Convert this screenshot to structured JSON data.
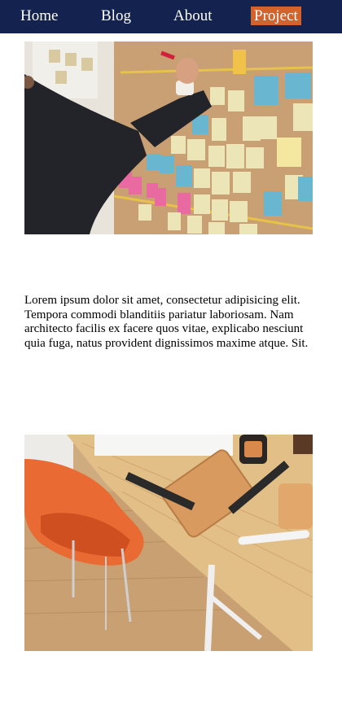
{
  "nav": {
    "items": [
      {
        "label": "Home",
        "active": false
      },
      {
        "label": "Blog",
        "active": false
      },
      {
        "label": "About",
        "active": false
      },
      {
        "label": "Project",
        "active": true
      }
    ],
    "background": "#13224e",
    "active_color": "#d3622b"
  },
  "main": {
    "body_text": "Lorem ipsum dolor sit amet, consectetur adipisicing elit. Tempora commodi blanditiis pariatur laboriosam. Nam architecto facilis ex facere quos vitae, explicabo nesciunt quia fuga, natus provident dignissimos maxime atque. Sit."
  }
}
